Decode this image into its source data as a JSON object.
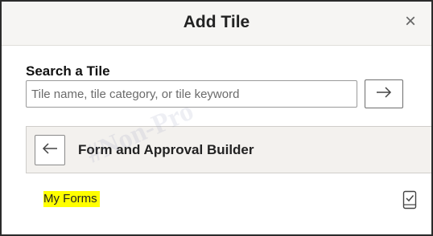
{
  "dialog": {
    "title": "Add Tile",
    "close_glyph": "×"
  },
  "search": {
    "label": "Search a Tile",
    "value": "",
    "placeholder": "Tile name, tile category, or tile keyword",
    "go_icon": "right-arrow-icon"
  },
  "category": {
    "back_icon": "left-arrow-icon",
    "title": "Form and Approval Builder"
  },
  "tiles": [
    {
      "label": "My Forms",
      "highlight_color": "#ffff00",
      "icon": "mobile-device-check-icon"
    }
  ],
  "watermark": "#Non-Pro"
}
